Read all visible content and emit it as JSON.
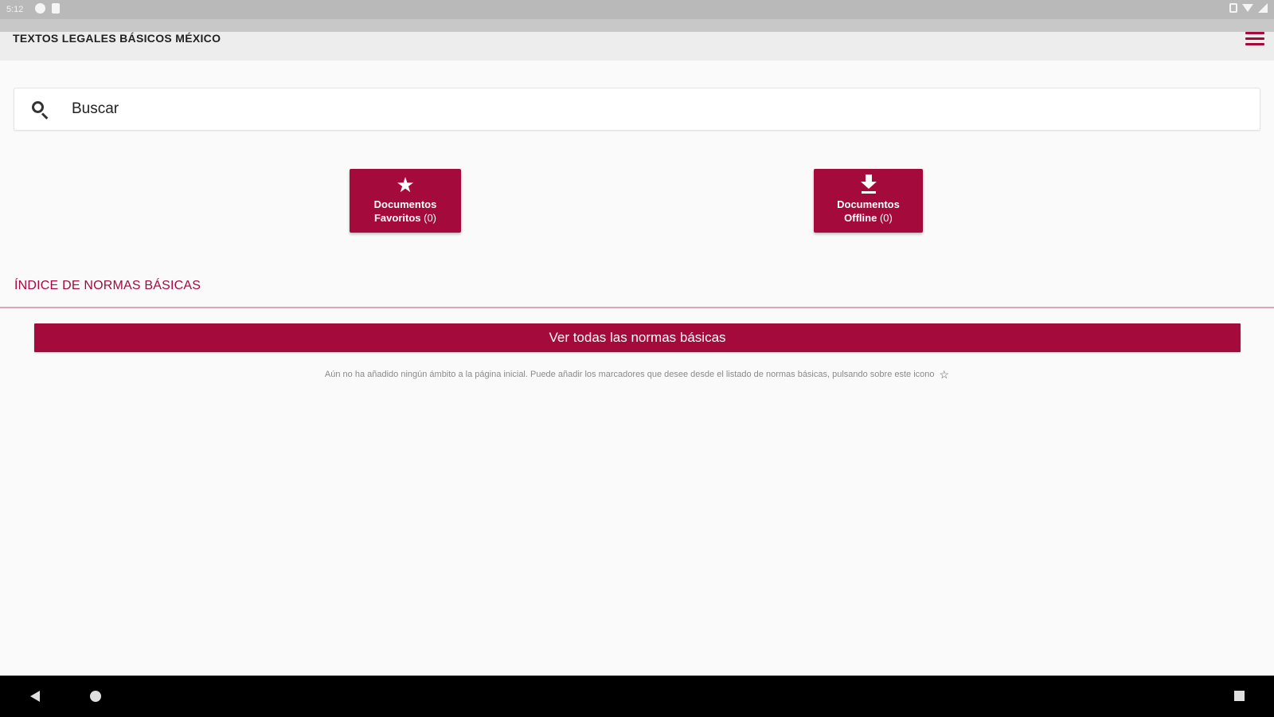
{
  "status_bar": {
    "time": "5:12"
  },
  "app_bar": {
    "title": "TEXTOS LEGALES BÁSICOS MÉXICO"
  },
  "search": {
    "placeholder": "Buscar"
  },
  "tiles": {
    "favorites": {
      "line1": "Documentos",
      "line2": "Favoritos",
      "count": "(0)",
      "icon": "star-icon"
    },
    "offline": {
      "line1": "Documentos",
      "line2": "Offline",
      "count": "(0)",
      "icon": "download-icon"
    }
  },
  "index": {
    "title": "ÍNDICE DE NORMAS BÁSICAS",
    "view_all_label": "Ver todas las normas básicas",
    "empty_note": "Aún no ha añadido ningún ámbito a la página inicial. Puede añadir los marcadores que desee desde el listado de normas básicas, pulsando sobre este icono"
  },
  "colors": {
    "accent": "#a50a3c",
    "background": "#fafafa",
    "app_bar": "#ededed"
  }
}
